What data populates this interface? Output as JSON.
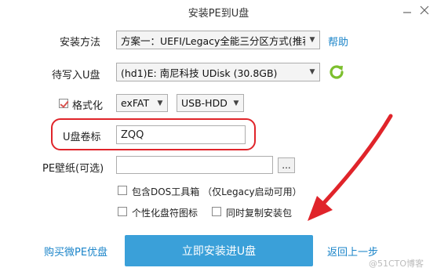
{
  "window": {
    "title": "安装PE到U盘"
  },
  "form": {
    "install_method_label": "安装方法",
    "install_method_value": "方案一：UEFI/Legacy全能三分区方式(推荐)",
    "help_label": "帮助",
    "target_disk_label": "待写入U盘",
    "target_disk_value": "(hd1)E: 南尼科技 UDisk (30.8GB)",
    "format_label": "格式化",
    "format_checked": true,
    "filesystem_value": "exFAT",
    "boot_mode_value": "USB-HDD",
    "volume_label_label": "U盘卷标",
    "volume_label_value": "ZQQ",
    "wallpaper_label": "PE壁纸(可选)",
    "wallpaper_value": "",
    "browse_label": "...",
    "dos_tools_label": "包含DOS工具箱 （仅Legacy启动可用）",
    "custom_icon_label": "个性化盘符图标",
    "copy_installer_label": "同时复制安装包"
  },
  "footer": {
    "buy_label": "购买微PE优盘",
    "install_button_label": "立即安装进U盘",
    "back_label": "返回上一步"
  },
  "watermark": "@51CTO博客",
  "colors": {
    "accent": "#3aa0d9",
    "link": "#1a84c9",
    "highlight": "#e0242a",
    "refresh": "#7cbf2d"
  },
  "icons": {
    "refresh": "refresh-icon",
    "minimize": "minimize-icon",
    "close": "close-icon",
    "annotation_arrow": "arrow-icon"
  }
}
